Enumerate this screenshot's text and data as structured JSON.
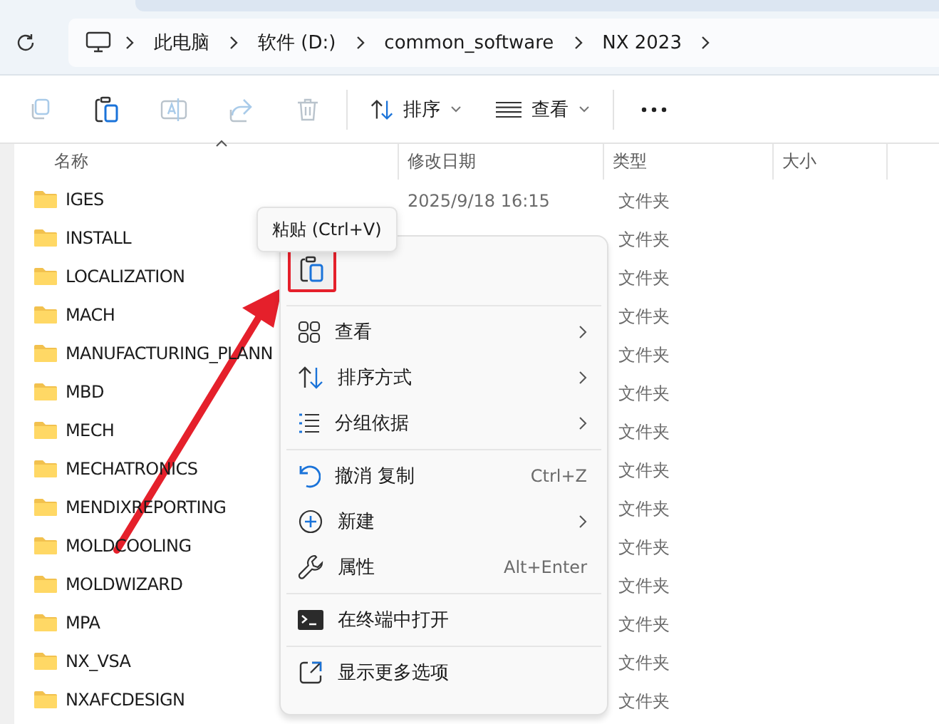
{
  "address_bar": {
    "crumbs": [
      "此电脑",
      "软件 (D:)",
      "common_software",
      "NX 2023"
    ]
  },
  "toolbar": {
    "buttons": [
      {
        "kind": "copy",
        "disabled": true
      },
      {
        "kind": "paste",
        "disabled": false
      },
      {
        "kind": "rename",
        "disabled": true
      },
      {
        "kind": "share",
        "disabled": true
      },
      {
        "kind": "delete",
        "disabled": true
      }
    ],
    "sort_label": "排序",
    "view_label": "查看"
  },
  "columns": [
    "名称",
    "修改日期",
    "类型",
    "大小"
  ],
  "rows": [
    {
      "name": "IGES",
      "modified": "2025/9/18 16:15",
      "type": "文件夹"
    },
    {
      "name": "INSTALL",
      "type": "文件夹"
    },
    {
      "name": "LOCALIZATION",
      "type": "文件夹"
    },
    {
      "name": "MACH",
      "type": "文件夹"
    },
    {
      "name": "MANUFACTURING_PLANN",
      "type": "文件夹"
    },
    {
      "name": "MBD",
      "type": "文件夹"
    },
    {
      "name": "MECH",
      "type": "文件夹"
    },
    {
      "name": "MECHATRONICS",
      "type": "文件夹"
    },
    {
      "name": "MENDIXREPORTING",
      "type": "文件夹"
    },
    {
      "name": "MOLDCOOLING",
      "type": "文件夹"
    },
    {
      "name": "MOLDWIZARD",
      "type": "文件夹"
    },
    {
      "name": "MPA",
      "type": "文件夹"
    },
    {
      "name": "NX_VSA",
      "type": "文件夹"
    },
    {
      "name": "NXAFCDESIGN",
      "type": "文件夹"
    }
  ],
  "context_menu": {
    "tooltip": "粘贴 (Ctrl+V)",
    "groups": [
      [
        {
          "label": "查看",
          "submenu": true
        },
        {
          "label": "排序方式",
          "submenu": true
        },
        {
          "label": "分组依据",
          "submenu": true
        }
      ],
      [
        {
          "label": "撤消 复制",
          "shortcut": "Ctrl+Z",
          "submenu": false
        },
        {
          "label": "新建",
          "submenu": true
        },
        {
          "label": "属性",
          "shortcut": "Alt+Enter",
          "submenu": false
        }
      ],
      [
        {
          "label": "在终端中打开",
          "submenu": false
        }
      ],
      [
        {
          "label": "显示更多选项",
          "submenu": false
        }
      ]
    ]
  }
}
